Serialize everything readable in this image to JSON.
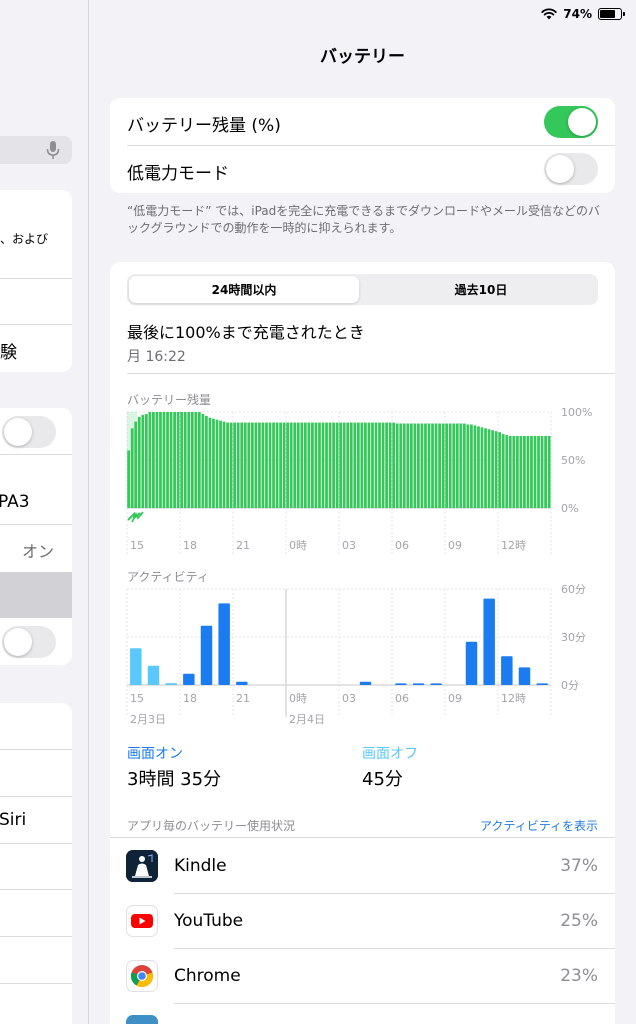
{
  "status_bar": {
    "battery_percent": "74%",
    "battery_level": 0.74
  },
  "sidebar": {
    "row_text_1": "、および",
    "row_text_2": "験",
    "row_text_3": "PA3",
    "row_text_4": "オン",
    "row_text_5": "Siri"
  },
  "title": "バッテリー",
  "settings": {
    "battery_percentage_label": "バッテリー残量 (%)",
    "battery_percentage_on": true,
    "low_power_label": "低電力モード",
    "low_power_on": false,
    "footnote": "“低電力モード” では、iPadを完全に充電できるまでダウンロードやメール受信などのバックグラウンドでの動作を一時的に抑えられます。"
  },
  "segments": {
    "tab_24h": "24時間以内",
    "tab_10d": "過去10日",
    "selected": "24時間以内"
  },
  "last_charged": {
    "title": "最後に100%まで充電されたとき",
    "time": "月 16:22"
  },
  "chart_data": [
    {
      "type": "bar",
      "title": "バッテリー残量",
      "x_ticks": [
        "15",
        "18",
        "21",
        "0時",
        "03",
        "06",
        "09",
        "12時"
      ],
      "y_ticks": [
        "100%",
        "50%",
        "0%"
      ],
      "ylim": [
        0,
        100
      ],
      "color": "#34c759",
      "charging_shade_until_bar": 3,
      "values": [
        60,
        83,
        90,
        95,
        97,
        98,
        100,
        100,
        100,
        100,
        100,
        100,
        100,
        100,
        100,
        100,
        100,
        100,
        100,
        100,
        100,
        98,
        96,
        94,
        93,
        92,
        91,
        90,
        89,
        89,
        89,
        89,
        89,
        89,
        89,
        89,
        89,
        89,
        89,
        89,
        89,
        89,
        89,
        89,
        89,
        89,
        89,
        89,
        89,
        89,
        89,
        89,
        89,
        89,
        89,
        89,
        89,
        89,
        89,
        89,
        89,
        89,
        89,
        89,
        89,
        89,
        89,
        89,
        89,
        89,
        89,
        89,
        89,
        89,
        89,
        89,
        88,
        88,
        88,
        88,
        88,
        88,
        88,
        88,
        88,
        88,
        88,
        88,
        88,
        88,
        88,
        88,
        88,
        88,
        88,
        88,
        87,
        87,
        86,
        85,
        84,
        83,
        82,
        81,
        80,
        79,
        77,
        76,
        75,
        75,
        75,
        75,
        75,
        75,
        75,
        75,
        75,
        75,
        75,
        75
      ]
    },
    {
      "type": "bar",
      "title": "アクティビティ",
      "x_ticks": [
        "15",
        "18",
        "21",
        "0時",
        "03",
        "06",
        "09",
        "12時"
      ],
      "date_labels": [
        "2月3日",
        "2月4日"
      ],
      "y_ticks": [
        "60分",
        "30分",
        "0分"
      ],
      "ylim": [
        0,
        60
      ],
      "series": [
        {
          "name": "画面オン",
          "color": "#1a7cf0",
          "values": [
            1,
            1,
            1,
            7,
            37,
            51,
            2,
            0,
            0,
            0,
            0,
            0,
            0,
            2,
            0,
            1,
            1,
            1,
            0,
            27,
            54,
            18,
            11,
            1
          ]
        },
        {
          "name": "画面オフ",
          "color": "#5ac8fa",
          "values": [
            23,
            12,
            1,
            0,
            0,
            0,
            0,
            0,
            0,
            0,
            0,
            0,
            0,
            0,
            0,
            0,
            0,
            0,
            0,
            0,
            0,
            0,
            0,
            0
          ]
        }
      ]
    }
  ],
  "usage": {
    "screen_on_label": "画面オン",
    "screen_on_value": "3時間 35分",
    "screen_off_label": "画面オフ",
    "screen_off_value": "45分"
  },
  "apps": {
    "header": "アプリ毎のバッテリー使用状況",
    "show_activity": "アクティビティを表示",
    "items": [
      {
        "name": "Kindle",
        "percent": "37%",
        "icon": "kindle-icon"
      },
      {
        "name": "YouTube",
        "percent": "25%",
        "icon": "youtube-icon"
      },
      {
        "name": "Chrome",
        "percent": "23%",
        "icon": "chrome-icon"
      }
    ]
  }
}
